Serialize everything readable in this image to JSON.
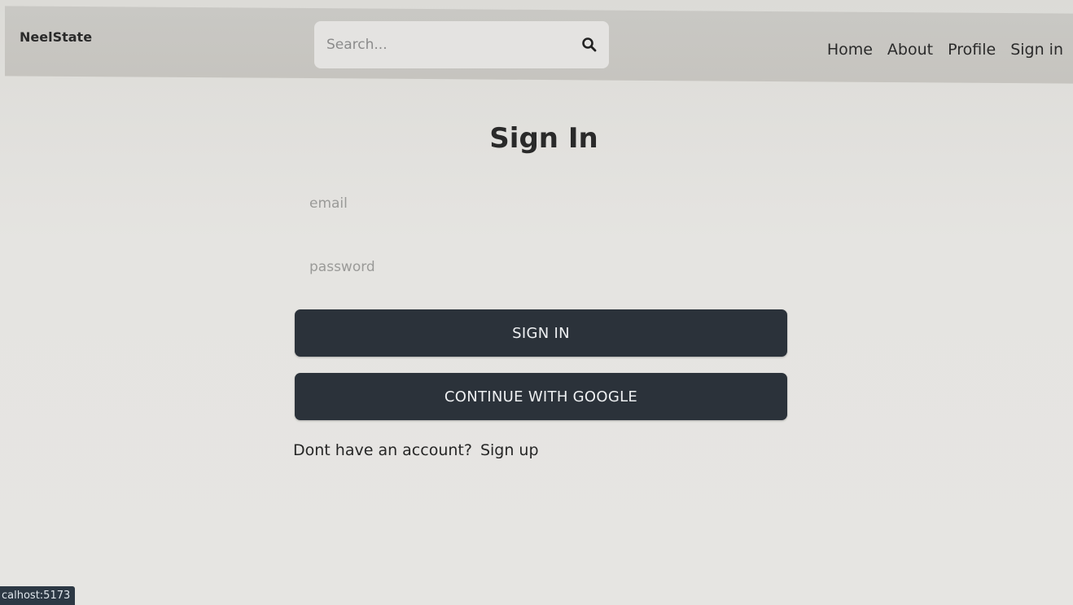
{
  "header": {
    "brand": "NeelState",
    "search": {
      "placeholder": "Search...",
      "value": ""
    },
    "nav": [
      {
        "label": "Home"
      },
      {
        "label": "About"
      },
      {
        "label": "Profile"
      },
      {
        "label": "Sign in"
      }
    ]
  },
  "main": {
    "title": "Sign In",
    "email": {
      "placeholder": "email",
      "value": ""
    },
    "password": {
      "placeholder": "password",
      "value": ""
    },
    "signin_button": "SIGN IN",
    "google_button": "CONTINUE WITH GOOGLE",
    "signup_prompt": "Dont have an account?",
    "signup_link": "Sign up"
  },
  "status_bar": {
    "url": "calhost:5173"
  },
  "icons": {
    "search": "search-icon"
  },
  "colors": {
    "button_bg": "#2b323a",
    "header_bg": "#c7c5c0",
    "page_bg": "#e4e3e0"
  }
}
